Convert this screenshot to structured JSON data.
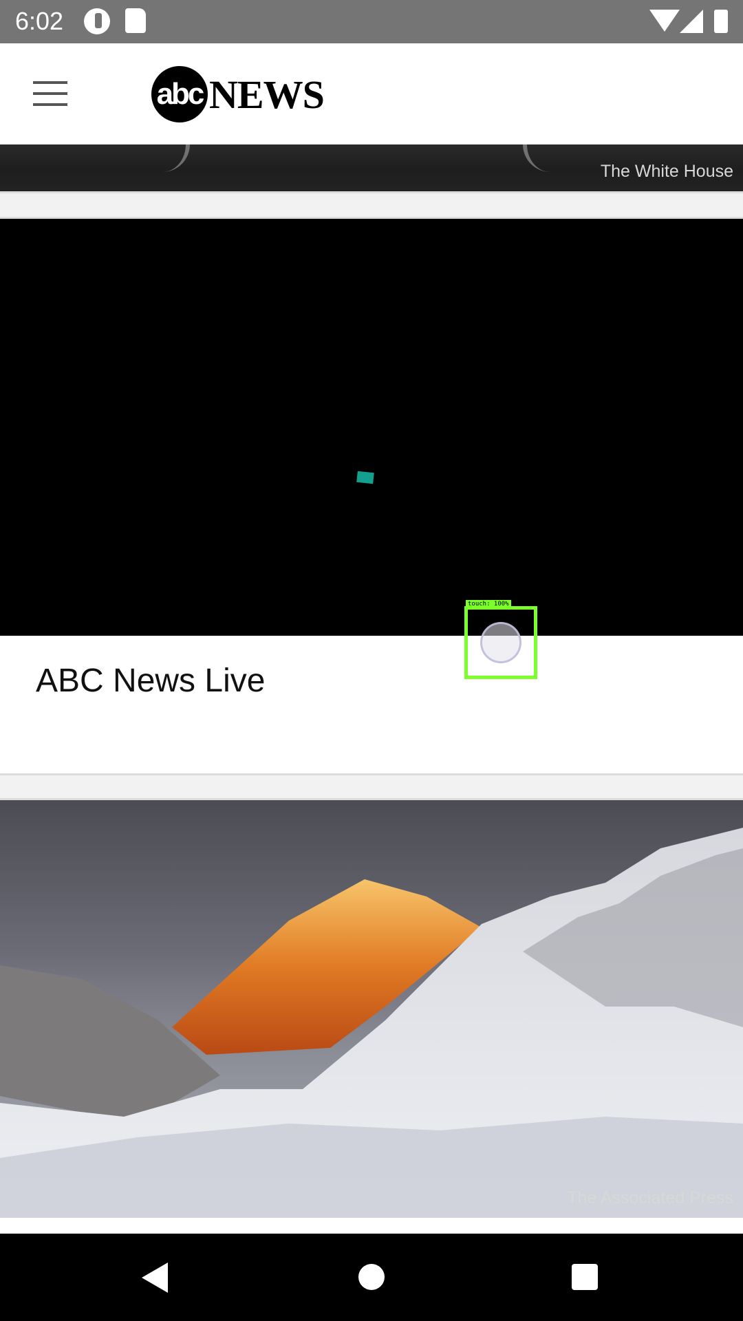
{
  "status_bar": {
    "time": "6:02",
    "icons": [
      "app-notification-icon",
      "sd-card-icon",
      "wifi-icon",
      "signal-icon",
      "battery-icon"
    ]
  },
  "header": {
    "menu_icon": "hamburger-menu-icon",
    "logo_abc": "abc",
    "logo_news": "NEWS"
  },
  "feed": {
    "cards": [
      {
        "image_credit": "The White House"
      },
      {
        "title": "ABC News Live"
      },
      {
        "image_credit": "The Associated Press"
      }
    ]
  },
  "overlay": {
    "touch_label": "touch: 100%"
  },
  "nav_bar": {
    "icons": [
      "back-icon",
      "home-icon",
      "recents-icon"
    ]
  },
  "colors": {
    "status_bar": "#757575",
    "touch_box": "#7cff2a",
    "video_background": "#000000",
    "video_marker": "#14a08f"
  }
}
